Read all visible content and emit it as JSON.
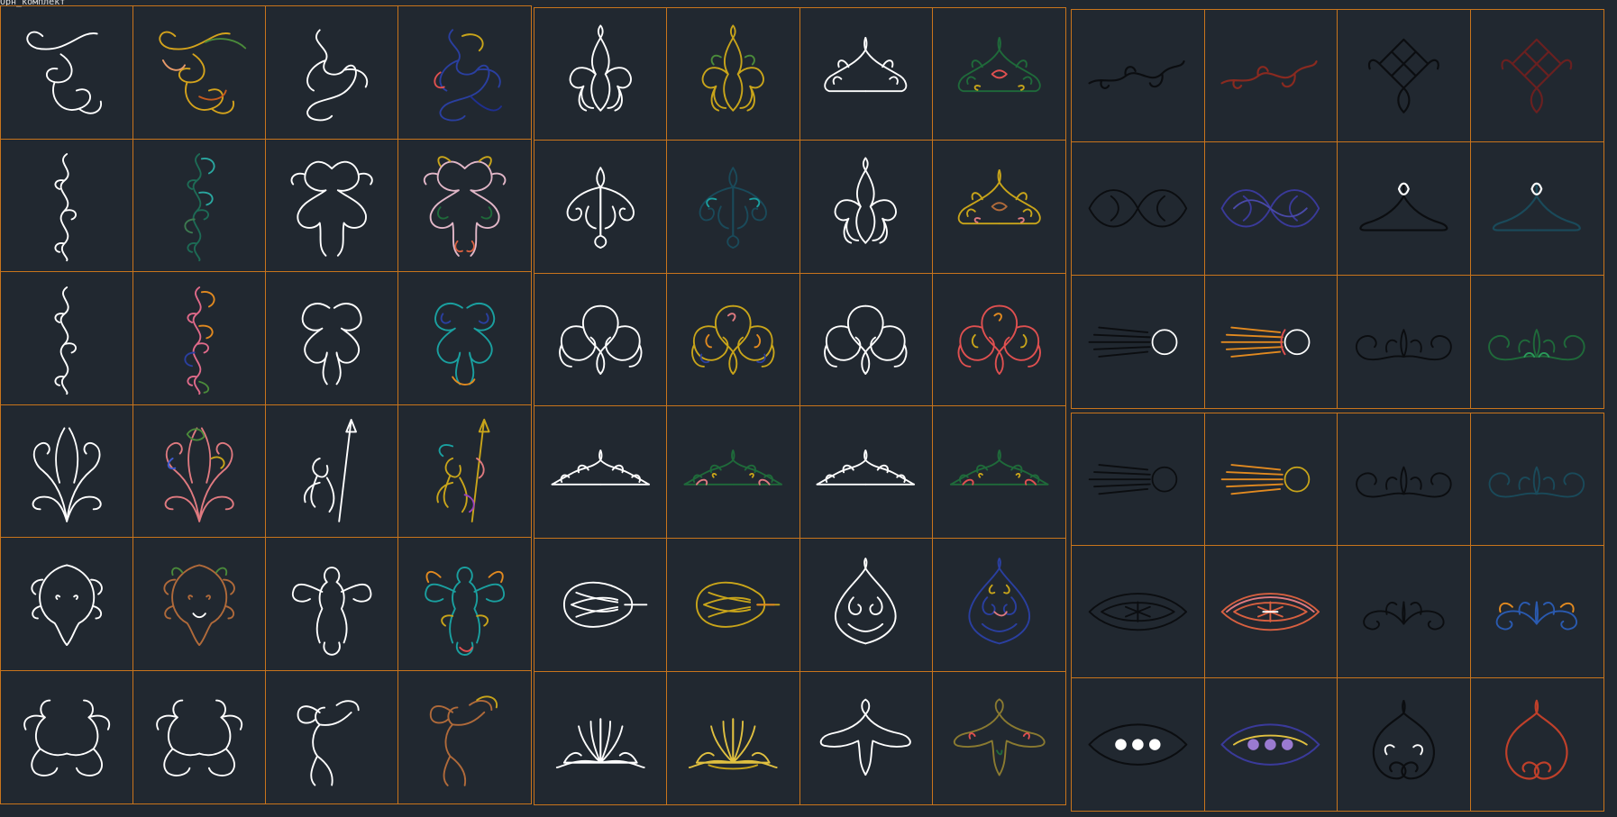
{
  "drawing": {
    "title_tag": "Орн_комплект"
  },
  "palette": {
    "background": "#212830",
    "frame": "#c8741c",
    "white": "#ffffff",
    "black_line": "#0b0d10"
  },
  "blocks": [
    {
      "id": "block-figures",
      "name": "figures-block",
      "cols": 4,
      "cells": [
        {
          "shape": "scroll",
          "colors": [
            "#ffffff"
          ]
        },
        {
          "shape": "scroll",
          "colors": [
            "#d4a31c",
            "#4a8a3a",
            "#c65a1e",
            "#e89a6a"
          ]
        },
        {
          "shape": "dragon",
          "colors": [
            "#ffffff"
          ]
        },
        {
          "shape": "dragon",
          "colors": [
            "#2a3fa0",
            "#c9a51a",
            "#e05050",
            "#1f2f90"
          ]
        },
        {
          "shape": "column",
          "colors": [
            "#ffffff"
          ]
        },
        {
          "shape": "column",
          "colors": [
            "#1d6b55",
            "#2aa7a0",
            "#3d7a50"
          ]
        },
        {
          "shape": "griffin",
          "colors": [
            "#ffffff"
          ]
        },
        {
          "shape": "griffin",
          "colors": [
            "#e2b7c8",
            "#c9a51a",
            "#1f6a3a",
            "#d86040"
          ]
        },
        {
          "shape": "column",
          "colors": [
            "#ffffff"
          ]
        },
        {
          "shape": "column",
          "colors": [
            "#e06a8a",
            "#e28a20",
            "#2a3fa0",
            "#4a8a3a"
          ]
        },
        {
          "shape": "twin-dragon",
          "colors": [
            "#ffffff"
          ]
        },
        {
          "shape": "twin-dragon",
          "colors": [
            "#1aa0a0",
            "#2a3fa0",
            "#e28a20"
          ]
        },
        {
          "shape": "bouquet",
          "colors": [
            "#ffffff"
          ]
        },
        {
          "shape": "bouquet",
          "colors": [
            "#e07a80",
            "#4a8a3a",
            "#c9a51a",
            "#3d5bd0"
          ]
        },
        {
          "shape": "spear-cherub",
          "colors": [
            "#ffffff"
          ]
        },
        {
          "shape": "spear-cherub",
          "colors": [
            "#c9a51a",
            "#e07a80",
            "#1aa0a0",
            "#9a40c0"
          ]
        },
        {
          "shape": "leaf-face",
          "colors": [
            "#ffffff"
          ]
        },
        {
          "shape": "leaf-face",
          "colors": [
            "#b06a3a",
            "#4a8a3a",
            "#ffffff"
          ]
        },
        {
          "shape": "winged-cherub",
          "colors": [
            "#ffffff"
          ]
        },
        {
          "shape": "winged-cherub",
          "colors": [
            "#1aa0a0",
            "#e28a20",
            "#c9a51a",
            "#e05050"
          ]
        },
        {
          "shape": "twin-cherub",
          "colors": [
            "#ffffff"
          ]
        },
        {
          "shape": "twin-cherub",
          "colors": [
            "#ffffff"
          ]
        },
        {
          "shape": "cupid",
          "colors": [
            "#ffffff"
          ]
        },
        {
          "shape": "cupid",
          "colors": [
            "#b06a3a",
            "#c9a51a"
          ]
        }
      ]
    },
    {
      "id": "block-crests",
      "name": "crests-block",
      "cols": 4,
      "cells": [
        {
          "shape": "fleur",
          "colors": [
            "#ffffff"
          ]
        },
        {
          "shape": "fleur",
          "colors": [
            "#c9a51a",
            "#4a8a3a"
          ]
        },
        {
          "shape": "crown",
          "colors": [
            "#ffffff"
          ]
        },
        {
          "shape": "crown",
          "colors": [
            "#1f6a3a",
            "#e05050",
            "#c9a51a"
          ]
        },
        {
          "shape": "pendant",
          "colors": [
            "#ffffff"
          ]
        },
        {
          "shape": "pendant",
          "colors": [
            "#1a4a5a",
            "#1aa0a0"
          ]
        },
        {
          "shape": "fleur",
          "colors": [
            "#ffffff"
          ]
        },
        {
          "shape": "crown",
          "colors": [
            "#c9a51a",
            "#b06a3a",
            "#e07a80"
          ]
        },
        {
          "shape": "knotwork",
          "colors": [
            "#ffffff"
          ]
        },
        {
          "shape": "knotwork",
          "colors": [
            "#c9a51a",
            "#e28a20",
            "#e07a80",
            "#2a3fa0"
          ]
        },
        {
          "shape": "knotwork",
          "colors": [
            "#ffffff"
          ]
        },
        {
          "shape": "knotwork",
          "colors": [
            "#e05050",
            "#c9a51a",
            "#e28a20"
          ]
        },
        {
          "shape": "band",
          "colors": [
            "#ffffff"
          ]
        },
        {
          "shape": "band",
          "colors": [
            "#1f6a3a",
            "#e07a80",
            "#c9a51a"
          ]
        },
        {
          "shape": "band",
          "colors": [
            "#ffffff"
          ]
        },
        {
          "shape": "band",
          "colors": [
            "#1f6a3a",
            "#e05050",
            "#c9a51a"
          ]
        },
        {
          "shape": "shell",
          "colors": [
            "#ffffff"
          ]
        },
        {
          "shape": "shell",
          "colors": [
            "#c9a51a",
            "#e28a20"
          ]
        },
        {
          "shape": "teardrop",
          "colors": [
            "#ffffff"
          ]
        },
        {
          "shape": "teardrop",
          "colors": [
            "#2a3fa0",
            "#c9a51a",
            "#e07a80"
          ]
        },
        {
          "shape": "fan",
          "colors": [
            "#ffffff"
          ]
        },
        {
          "shape": "fan",
          "colors": [
            "#e0c040",
            "#c9a51a"
          ]
        },
        {
          "shape": "bird",
          "colors": [
            "#ffffff"
          ]
        },
        {
          "shape": "bird",
          "colors": [
            "#8a7a30",
            "#e05050",
            "#1f6a3a"
          ]
        }
      ]
    },
    {
      "id": "block-knots",
      "name": "knots-block",
      "cols": 4,
      "cells": [
        {
          "shape": "swirl",
          "colors": [
            "#0b0d10"
          ]
        },
        {
          "shape": "swirl",
          "colors": [
            "#8a2a20"
          ]
        },
        {
          "shape": "diamond-knot",
          "colors": [
            "#0b0d10"
          ]
        },
        {
          "shape": "diamond-knot",
          "colors": [
            "#6a2020"
          ]
        },
        {
          "shape": "knot-band",
          "colors": [
            "#0b0d10"
          ]
        },
        {
          "shape": "knot-band",
          "colors": [
            "#3a3a9a",
            "#4a4aaa"
          ]
        },
        {
          "shape": "chevron",
          "colors": [
            "#0b0d10",
            "#ffffff"
          ]
        },
        {
          "shape": "chevron",
          "colors": [
            "#1a4a5a",
            "#ffffff"
          ]
        },
        {
          "shape": "sun-rays",
          "colors": [
            "#0b0d10",
            "#ffffff"
          ]
        },
        {
          "shape": "sun-rays",
          "colors": [
            "#e28a20",
            "#ffffff",
            "#e05050"
          ]
        },
        {
          "shape": "lotus-arc",
          "colors": [
            "#0b0d10"
          ]
        },
        {
          "shape": "lotus-arc",
          "colors": [
            "#1f6a3a",
            "#2a9a5a"
          ]
        }
      ]
    },
    {
      "id": "block-motifs",
      "name": "motifs-block",
      "cols": 4,
      "cells": [
        {
          "shape": "sun-rays",
          "colors": [
            "#0b0d10"
          ]
        },
        {
          "shape": "sun-rays",
          "colors": [
            "#e28a20",
            "#c9a51a"
          ]
        },
        {
          "shape": "lotus-arc",
          "colors": [
            "#0b0d10"
          ]
        },
        {
          "shape": "lotus-arc",
          "colors": [
            "#1a4a5a"
          ]
        },
        {
          "shape": "eye",
          "colors": [
            "#0b0d10"
          ]
        },
        {
          "shape": "eye",
          "colors": [
            "#d86040",
            "#e07a80",
            "#ffffff"
          ]
        },
        {
          "shape": "double-scroll",
          "colors": [
            "#0b0d10"
          ]
        },
        {
          "shape": "double-scroll",
          "colors": [
            "#2a5ab0",
            "#e28a20"
          ]
        },
        {
          "shape": "eye-dots",
          "colors": [
            "#0b0d10",
            "#ffffff"
          ]
        },
        {
          "shape": "eye-dots",
          "colors": [
            "#3a3a9a",
            "#9a7ad0",
            "#e0c040"
          ]
        },
        {
          "shape": "spiral-heart",
          "colors": [
            "#0b0d10",
            "#ffffff"
          ]
        },
        {
          "shape": "spiral-heart",
          "colors": [
            "#c0402a"
          ]
        }
      ]
    }
  ]
}
